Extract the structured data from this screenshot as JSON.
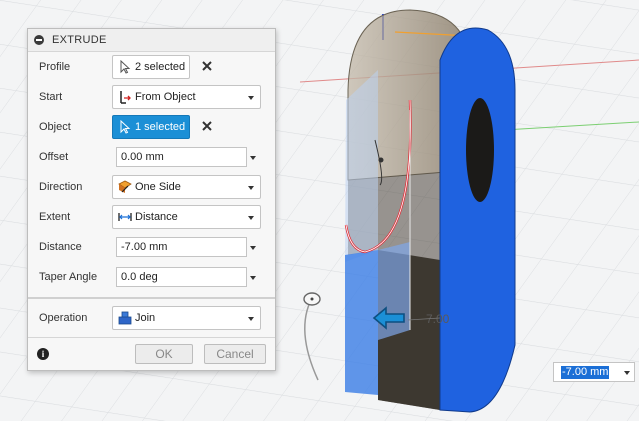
{
  "panel": {
    "title": "EXTRUDE",
    "rows": {
      "profile": {
        "label": "Profile",
        "value": "2 selected"
      },
      "start": {
        "label": "Start",
        "value": "From Object"
      },
      "object": {
        "label": "Object",
        "value": "1 selected"
      },
      "offset": {
        "label": "Offset",
        "value": "0.00 mm"
      },
      "direction": {
        "label": "Direction",
        "value": "One Side"
      },
      "extent": {
        "label": "Extent",
        "value": "Distance"
      },
      "distance": {
        "label": "Distance",
        "value": "-7.00 mm"
      },
      "taper": {
        "label": "Taper Angle",
        "value": "0.0 deg"
      },
      "operation": {
        "label": "Operation",
        "value": "Join"
      }
    },
    "ok_label": "OK",
    "cancel_label": "Cancel"
  },
  "canvas": {
    "dimension_label": "7.00",
    "distance_input": "-7.00 mm"
  },
  "colors": {
    "accent": "#1b8fd6",
    "body_blue": "#1f62e0",
    "profile_red": "#e0303a"
  }
}
